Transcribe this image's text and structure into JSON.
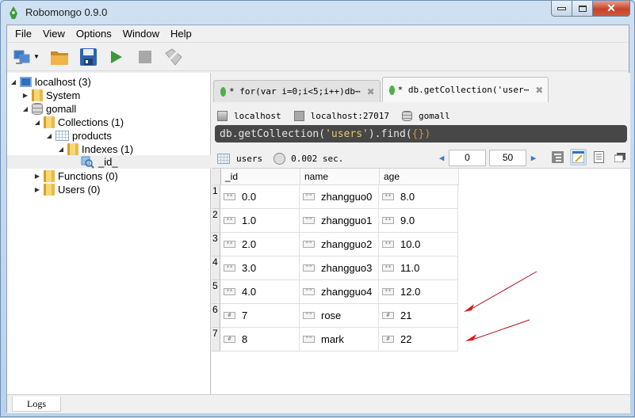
{
  "window": {
    "title": "Robomongo 0.9.0",
    "controls": [
      "minimize",
      "maximize",
      "close"
    ]
  },
  "menu": [
    "File",
    "View",
    "Options",
    "Window",
    "Help"
  ],
  "toolbar": {
    "icons": [
      "connect-icon",
      "dropdown-icon",
      "open-folder-icon",
      "save-icon",
      "execute-icon",
      "stop-icon",
      "orientation-icon"
    ]
  },
  "explorer": {
    "items": [
      {
        "label": "localhost (3)",
        "icon": "server-icon",
        "expanded": true,
        "level": 0
      },
      {
        "label": "System",
        "icon": "folder-icon",
        "expanded": false,
        "level": 1
      },
      {
        "label": "gomall",
        "icon": "database-icon",
        "expanded": true,
        "level": 1
      },
      {
        "label": "Collections (1)",
        "icon": "folder-icon",
        "expanded": true,
        "level": 2
      },
      {
        "label": "products",
        "icon": "collection-icon",
        "expanded": true,
        "level": 3
      },
      {
        "label": "Indexes (1)",
        "icon": "folder-icon",
        "expanded": true,
        "level": 4
      },
      {
        "label": "_id_",
        "icon": "index-icon",
        "level": 5,
        "selected": true
      },
      {
        "label": "Functions (0)",
        "icon": "folder-icon",
        "expanded": false,
        "level": 2
      },
      {
        "label": "Users (0)",
        "icon": "folder-icon",
        "expanded": false,
        "level": 2
      }
    ]
  },
  "tabs": [
    {
      "label": "* for(var i=0;i<5;i++)db⋯",
      "active": false
    },
    {
      "label": "* db.getCollection('user⋯",
      "active": true
    }
  ],
  "connection": {
    "server": "localhost",
    "address": "localhost:27017",
    "database": "gomall"
  },
  "query": {
    "prefix": "db.getCollection(",
    "string": "'users'",
    "middle": ").find(",
    "arg": "{}",
    "suffix": ")"
  },
  "result": {
    "collection": "users",
    "time": "0.002 sec.",
    "skip": "0",
    "limit": "50",
    "columns": [
      "_id",
      "name",
      "age"
    ],
    "rows": [
      {
        "num": "1",
        "id": "0.0",
        "id_type": "double",
        "name": "zhangguo0",
        "age": "8.0",
        "age_type": "double"
      },
      {
        "num": "2",
        "id": "1.0",
        "id_type": "double",
        "name": "zhangguo1",
        "age": "9.0",
        "age_type": "double"
      },
      {
        "num": "3",
        "id": "2.0",
        "id_type": "double",
        "name": "zhangguo2",
        "age": "10.0",
        "age_type": "double"
      },
      {
        "num": "4",
        "id": "3.0",
        "id_type": "double",
        "name": "zhangguo3",
        "age": "11.0",
        "age_type": "double"
      },
      {
        "num": "5",
        "id": "4.0",
        "id_type": "double",
        "name": "zhangguo4",
        "age": "12.0",
        "age_type": "double"
      },
      {
        "num": "6",
        "id": "7",
        "id_type": "int",
        "name": "rose",
        "age": "21",
        "age_type": "int"
      },
      {
        "num": "7",
        "id": "8",
        "id_type": "int",
        "name": "mark",
        "age": "22",
        "age_type": "int"
      }
    ],
    "type_badges": {
      "double": "**",
      "int": "#",
      "string": "\"\""
    }
  },
  "logs": {
    "label": "Logs"
  },
  "colors": {
    "annotation_arrow": "#e01818",
    "accent_leaf": "#4bb14b",
    "close_button": "#c6432a"
  }
}
